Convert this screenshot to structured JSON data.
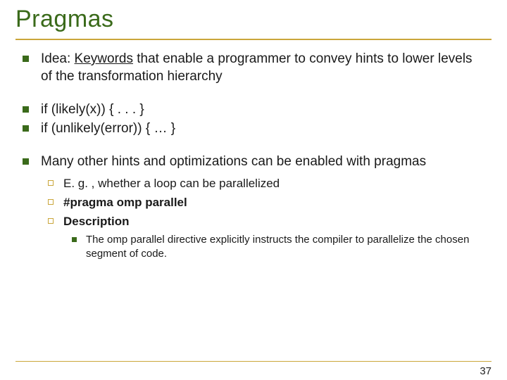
{
  "title": "Pragmas",
  "bullets": {
    "b1_pre": "Idea: ",
    "b1_u": "Keywords",
    "b1_post": " that enable a programmer to convey hints to lower levels of the transformation hierarchy",
    "b2": "if (likely(x)) { . . . }",
    "b3": "if (unlikely(error)) { … }",
    "b4": "Many other hints and optimizations can be enabled with pragmas",
    "sub": {
      "s1": "E. g. , whether a loop can be parallelized",
      "s2": "#pragma omp parallel",
      "s3": "Description",
      "s3n": "The omp parallel directive explicitly instructs the compiler to parallelize the chosen segment of code."
    }
  },
  "page": "37"
}
